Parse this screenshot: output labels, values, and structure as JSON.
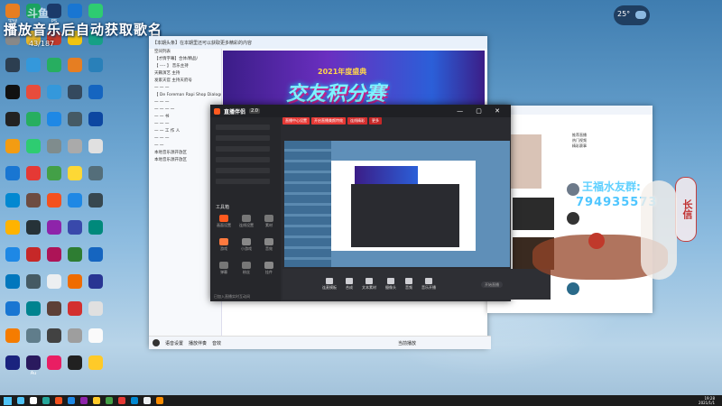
{
  "overlay": {
    "title": "播放音乐后自动获取歌名",
    "count": "43/187",
    "corner_badge": "斗鱼"
  },
  "weather": {
    "temp": "25°",
    "unit": "C"
  },
  "desktop_icons": [
    {
      "label": "宝绿",
      "color": "#e67e22"
    },
    {
      "label": "",
      "color": "#1aa260"
    },
    {
      "label": "PS",
      "color": "#1b3a6a"
    },
    {
      "label": "",
      "color": "#1976d2"
    },
    {
      "label": "",
      "color": "#2ecc71"
    },
    {
      "label": "",
      "color": "#888"
    },
    {
      "label": "",
      "color": "#e3b52e"
    },
    {
      "label": "",
      "color": "#c0392b"
    },
    {
      "label": "",
      "color": "#f1c40f"
    },
    {
      "label": "",
      "color": "#16a085"
    },
    {
      "label": "",
      "color": "#2c3e50"
    },
    {
      "label": "",
      "color": "#3498db"
    },
    {
      "label": "",
      "color": "#27ae60"
    },
    {
      "label": "",
      "color": "#e67e22"
    },
    {
      "label": "",
      "color": "#2980b9"
    },
    {
      "label": "",
      "color": "#111"
    },
    {
      "label": "",
      "color": "#e74c3c"
    },
    {
      "label": "",
      "color": "#3498db"
    },
    {
      "label": "",
      "color": "#34495e"
    },
    {
      "label": "",
      "color": "#1565c0"
    },
    {
      "label": "",
      "color": "#222"
    },
    {
      "label": "",
      "color": "#27ae60"
    },
    {
      "label": "",
      "color": "#1e88e5"
    },
    {
      "label": "",
      "color": "#455a64"
    },
    {
      "label": "",
      "color": "#0d47a1"
    },
    {
      "label": "",
      "color": "#f39c12"
    },
    {
      "label": "",
      "color": "#2ecc71"
    },
    {
      "label": "",
      "color": "#7f8c8d"
    },
    {
      "label": "",
      "color": "#aaa"
    },
    {
      "label": "",
      "color": "#e0e0e0"
    },
    {
      "label": "",
      "color": "#1976d2"
    },
    {
      "label": "",
      "color": "#e53935"
    },
    {
      "label": "",
      "color": "#43a047"
    },
    {
      "label": "",
      "color": "#fdd835"
    },
    {
      "label": "",
      "color": "#546e7a"
    },
    {
      "label": "",
      "color": "#0288d1"
    },
    {
      "label": "",
      "color": "#6d4c41"
    },
    {
      "label": "",
      "color": "#f4511e"
    },
    {
      "label": "",
      "color": "#1e88e5"
    },
    {
      "label": "",
      "color": "#37474f"
    },
    {
      "label": "",
      "color": "#ffb300"
    },
    {
      "label": "",
      "color": "#263238"
    },
    {
      "label": "",
      "color": "#8e24aa"
    },
    {
      "label": "",
      "color": "#3949ab"
    },
    {
      "label": "",
      "color": "#00897b"
    },
    {
      "label": "",
      "color": "#1e88e5"
    },
    {
      "label": "",
      "color": "#c62828"
    },
    {
      "label": "",
      "color": "#ad1457"
    },
    {
      "label": "",
      "color": "#2e7d32"
    },
    {
      "label": "",
      "color": "#1565c0"
    },
    {
      "label": "",
      "color": "#0277bd"
    },
    {
      "label": "",
      "color": "#455a64"
    },
    {
      "label": "",
      "color": "#eceff1"
    },
    {
      "label": "",
      "color": "#ef6c00"
    },
    {
      "label": "",
      "color": "#283593"
    },
    {
      "label": "",
      "color": "#1976d2"
    },
    {
      "label": "",
      "color": "#00838f"
    },
    {
      "label": "",
      "color": "#5d4037"
    },
    {
      "label": "",
      "color": "#d32f2f"
    },
    {
      "label": "",
      "color": "#e0e0e0"
    },
    {
      "label": "",
      "color": "#f57c00"
    },
    {
      "label": "",
      "color": "#607d8b"
    },
    {
      "label": "",
      "color": "#424242"
    },
    {
      "label": "",
      "color": "#9e9e9e"
    },
    {
      "label": "",
      "color": "#fafafa"
    },
    {
      "label": "",
      "color": "#1a237e"
    },
    {
      "label": "Au",
      "color": "#2a1a5e"
    },
    {
      "label": "",
      "color": "#e91e63"
    },
    {
      "label": "",
      "color": "#212121"
    },
    {
      "label": "",
      "color": "#ffca28"
    }
  ],
  "chat_window": {
    "title": "【本期头条】在本期里还可以获取更多精彩的内容",
    "banner_sub": "2021年度盛典",
    "banner_main": "交友积分赛",
    "tree_rows": [
      "空间列表",
      "【才情字幕】合体/精品/",
      "【 ---- 】 音乐主持",
      "  天籁演艺 主持",
      "  发家天官  主持天府号",
      "  一 一 一",
      "【 De Foreman Rapi Shop Dialogue 】",
      "  一 一 一",
      "  一 一 一 一",
      "  一 一  书",
      "  一 一 一",
      "  一 一 工 作 人",
      "  一 一 一",
      "  一 一",
      "  本地音乐源开放区",
      "  本地音乐源开放区"
    ],
    "bottom_items": [
      "语音设置",
      "播放伴奏",
      "音效"
    ],
    "bottom_right": "当前播放"
  },
  "live_app": {
    "logo": "直播伴侣",
    "version": "2.0",
    "tabs": [
      "直播中心设置",
      "开启直播美颜特效",
      "连线精彩",
      "更多"
    ],
    "tab_colors": [
      "#e53935",
      "#e53935",
      "#d32f2f",
      "#c62828"
    ],
    "side_section": "工具箱",
    "tools": [
      "画面设置",
      "连线设置",
      "素材",
      "游戏",
      "小游戏",
      "音效",
      "弹幕",
      "粉丝",
      "挂件"
    ],
    "controls": [
      "连麦模板",
      "合成",
      "文本素材",
      "摄像头",
      "音频",
      "音乐开播"
    ],
    "go_live": "开始直播",
    "footer": "已加入直播实时互动间"
  },
  "browser_window": {
    "items": [
      "推荐直播",
      "热门视频",
      "精彩赛事"
    ]
  },
  "qq_overlay": {
    "label": "王福水友群:",
    "number": "794935573",
    "vertical_text": "长信"
  },
  "clock": {
    "time": "19:28",
    "date": "2021/1/1"
  },
  "taskbar_colors": [
    "#4fc3f7",
    "#fff",
    "#26a69a",
    "#f4511e",
    "#1e88e5",
    "#8e24aa",
    "#ffca28",
    "#43a047",
    "#e53935",
    "#0288d1",
    "#eceff1",
    "#fb8c00"
  ]
}
